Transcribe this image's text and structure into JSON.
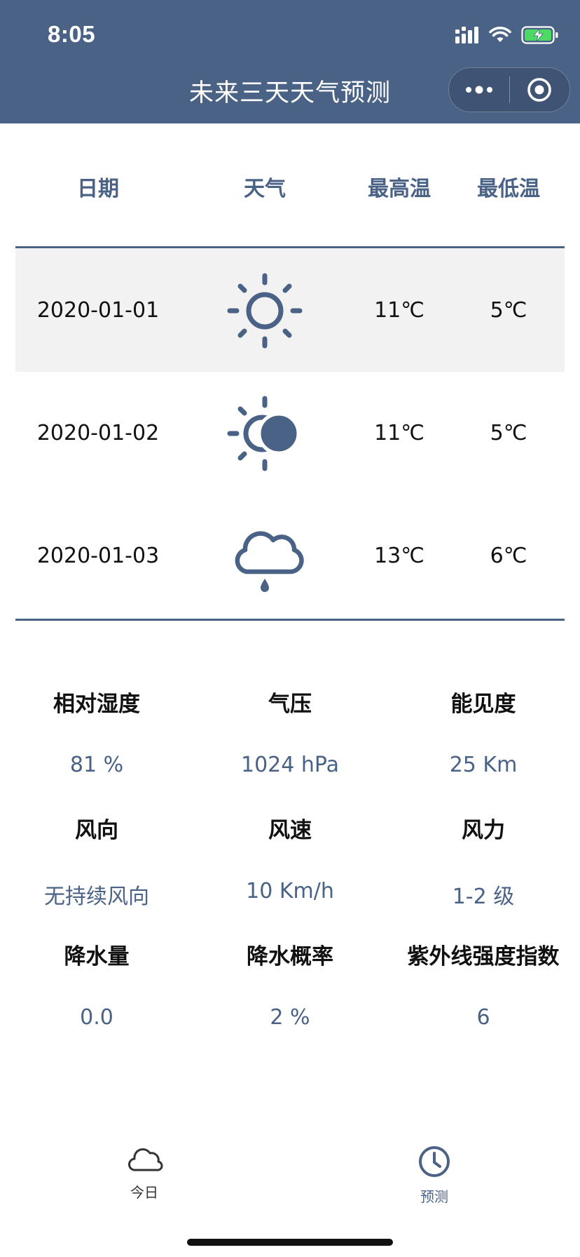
{
  "status_bar": {
    "time": "8:05"
  },
  "nav": {
    "title": "未来三天天气预测",
    "more_icon": "more-dots-icon",
    "close_icon": "target-circle-icon"
  },
  "forecast": {
    "headers": {
      "date": "日期",
      "weather": "天气",
      "high": "最高温",
      "low": "最低温"
    },
    "rows": [
      {
        "date": "2020-01-01",
        "icon": "sun-icon",
        "high": "11℃",
        "low": "5℃"
      },
      {
        "date": "2020-01-02",
        "icon": "partly-sunny-icon",
        "high": "11℃",
        "low": "5℃"
      },
      {
        "date": "2020-01-03",
        "icon": "cloud-rain-icon",
        "high": "13℃",
        "low": "6℃"
      }
    ]
  },
  "details": [
    {
      "label": "相对湿度",
      "value": "81 %"
    },
    {
      "label": "气压",
      "value": "1024 hPa"
    },
    {
      "label": "能见度",
      "value": "25 Km"
    },
    {
      "label": "风向",
      "value": "无持续风向"
    },
    {
      "label": "风速",
      "value": "10 Km/h"
    },
    {
      "label": "风力",
      "value": "1-2 级"
    },
    {
      "label": "降水量",
      "value": "0.0"
    },
    {
      "label": "降水概率",
      "value": "2 %"
    },
    {
      "label": "紫外线强度指数",
      "value": "6"
    }
  ],
  "tabbar": [
    {
      "label": "今日",
      "icon": "cloud-icon",
      "active": false
    },
    {
      "label": "预测",
      "icon": "clock-icon",
      "active": true
    }
  ],
  "colors": {
    "primary": "#4a6285",
    "inactive": "#333333",
    "row_shade": "#f2f2f2"
  }
}
